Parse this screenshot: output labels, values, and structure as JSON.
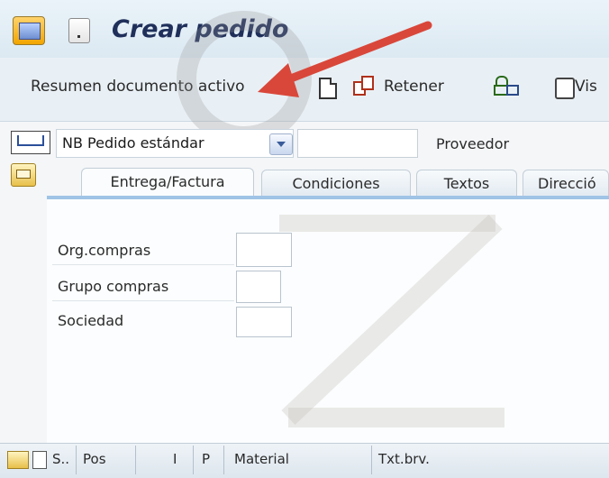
{
  "window": {
    "title": "Crear pedido"
  },
  "toolbar": {
    "summary_label": "Resumen documento activo",
    "hold_label": "Retener",
    "view_label": "Vis",
    "icons": [
      "new-document-icon",
      "copy-document-icon",
      "lock-icon",
      "view-icon"
    ]
  },
  "header": {
    "doc_type": "NB Pedido estándar",
    "vendor_label": "Proveedor",
    "vendor_value": ""
  },
  "tabs": [
    {
      "label": "Entrega/Factura",
      "active": true
    },
    {
      "label": "Condiciones",
      "active": false
    },
    {
      "label": "Textos",
      "active": false
    },
    {
      "label": "Direcció",
      "active": false
    }
  ],
  "fields": [
    {
      "label": "Org.compras",
      "value": ""
    },
    {
      "label": "Grupo compras",
      "value": ""
    },
    {
      "label": "Sociedad",
      "value": ""
    }
  ],
  "item_grid": {
    "columns": [
      "S..",
      "Pos",
      "I",
      "P",
      "Material",
      "Txt.brv."
    ]
  },
  "colors": {
    "title_text": "#1f2f5a",
    "annotation_arrow": "#d9473a",
    "tab_strip": "#9fc4e6"
  }
}
